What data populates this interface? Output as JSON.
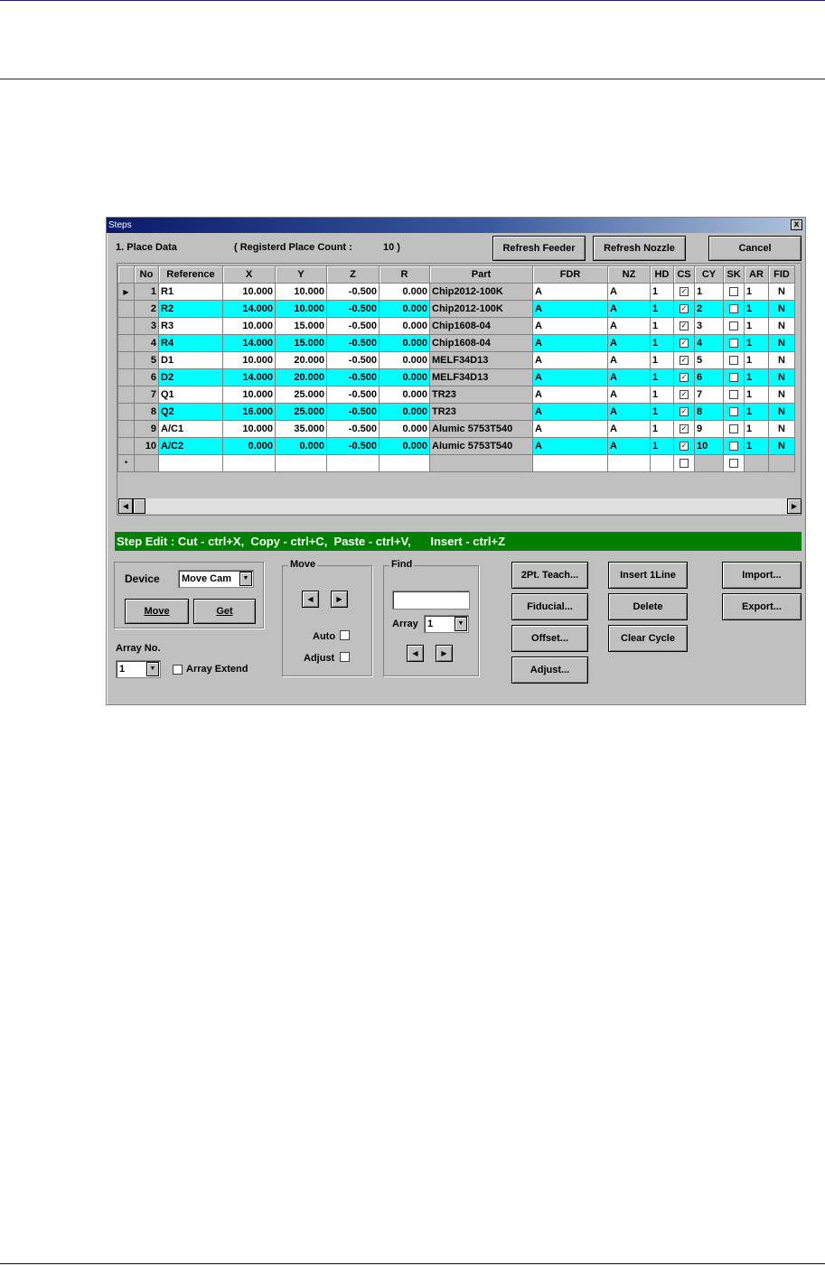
{
  "window": {
    "title": "Steps",
    "close_glyph": "x"
  },
  "header": {
    "section_label": "1. Place Data",
    "count_label": "( Registerd Place Count :",
    "count_value": "10 )",
    "refresh_feeder": "Refresh Feeder",
    "refresh_nozzle": "Refresh Nozzle",
    "cancel": "Cancel"
  },
  "table": {
    "columns": [
      "No",
      "Reference",
      "X",
      "Y",
      "Z",
      "R",
      "Part",
      "FDR",
      "NZ",
      "HD",
      "CS",
      "CY",
      "SK",
      "AR",
      "FID"
    ],
    "rows": [
      {
        "no": "1",
        "ref": "R1",
        "x": "10.000",
        "y": "10.000",
        "z": "-0.500",
        "r": "0.000",
        "part": "Chip2012-100K",
        "fdr": "A",
        "nz": "A",
        "hd": "1",
        "cs": true,
        "cy": "1",
        "sk": false,
        "ar": "1",
        "fid": "N",
        "highlight": false,
        "current": true
      },
      {
        "no": "2",
        "ref": "R2",
        "x": "14.000",
        "y": "10.000",
        "z": "-0.500",
        "r": "0.000",
        "part": "Chip2012-100K",
        "fdr": "A",
        "nz": "A",
        "hd": "1",
        "cs": true,
        "cy": "2",
        "sk": false,
        "ar": "1",
        "fid": "N",
        "highlight": true,
        "current": false
      },
      {
        "no": "3",
        "ref": "R3",
        "x": "10.000",
        "y": "15.000",
        "z": "-0.500",
        "r": "0.000",
        "part": "Chip1608-04",
        "fdr": "A",
        "nz": "A",
        "hd": "1",
        "cs": true,
        "cy": "3",
        "sk": false,
        "ar": "1",
        "fid": "N",
        "highlight": false,
        "current": false
      },
      {
        "no": "4",
        "ref": "R4",
        "x": "14.000",
        "y": "15.000",
        "z": "-0.500",
        "r": "0.000",
        "part": "Chip1608-04",
        "fdr": "A",
        "nz": "A",
        "hd": "1",
        "cs": true,
        "cy": "4",
        "sk": false,
        "ar": "1",
        "fid": "N",
        "highlight": true,
        "current": false
      },
      {
        "no": "5",
        "ref": "D1",
        "x": "10.000",
        "y": "20.000",
        "z": "-0.500",
        "r": "0.000",
        "part": "MELF34D13",
        "fdr": "A",
        "nz": "A",
        "hd": "1",
        "cs": true,
        "cy": "5",
        "sk": false,
        "ar": "1",
        "fid": "N",
        "highlight": false,
        "current": false
      },
      {
        "no": "6",
        "ref": "D2",
        "x": "14.000",
        "y": "20.000",
        "z": "-0.500",
        "r": "0.000",
        "part": "MELF34D13",
        "fdr": "A",
        "nz": "A",
        "hd": "1",
        "cs": true,
        "cy": "6",
        "sk": false,
        "ar": "1",
        "fid": "N",
        "highlight": true,
        "current": false
      },
      {
        "no": "7",
        "ref": "Q1",
        "x": "10.000",
        "y": "25.000",
        "z": "-0.500",
        "r": "0.000",
        "part": "TR23",
        "fdr": "A",
        "nz": "A",
        "hd": "1",
        "cs": true,
        "cy": "7",
        "sk": false,
        "ar": "1",
        "fid": "N",
        "highlight": false,
        "current": false
      },
      {
        "no": "8",
        "ref": "Q2",
        "x": "16.000",
        "y": "25.000",
        "z": "-0.500",
        "r": "0.000",
        "part": "TR23",
        "fdr": "A",
        "nz": "A",
        "hd": "1",
        "cs": true,
        "cy": "8",
        "sk": false,
        "ar": "1",
        "fid": "N",
        "highlight": true,
        "current": false
      },
      {
        "no": "9",
        "ref": "A/C1",
        "x": "10.000",
        "y": "35.000",
        "z": "-0.500",
        "r": "0.000",
        "part": "Alumic 5753T540",
        "fdr": "A",
        "nz": "A",
        "hd": "1",
        "cs": true,
        "cy": "9",
        "sk": false,
        "ar": "1",
        "fid": "N",
        "highlight": false,
        "current": false
      },
      {
        "no": "10",
        "ref": "A/C2",
        "x": "0.000",
        "y": "0.000",
        "z": "-0.500",
        "r": "0.000",
        "part": "Alumic 5753T540",
        "fdr": "A",
        "nz": "A",
        "hd": "1",
        "cs": true,
        "cy": "10",
        "sk": false,
        "ar": "1",
        "fid": "N",
        "highlight": true,
        "current": false
      }
    ],
    "new_row_marker": "*",
    "current_row_marker": "▶"
  },
  "status_text": "Step Edit : Cut - ctrl+X,  Copy - ctrl+C,  Paste - ctrl+V,      Insert - ctrl+Z",
  "device": {
    "label": "Device",
    "value": "Move Cam",
    "move": "Move",
    "get": "Get"
  },
  "array": {
    "label": "Array No.",
    "value": "1",
    "extend": "Array Extend"
  },
  "move_group": {
    "title": "Move",
    "auto": "Auto",
    "adjust": "Adjust"
  },
  "find_group": {
    "title": "Find",
    "array_label": "Array",
    "array_value": "1"
  },
  "buttons": {
    "teach": "2Pt. Teach...",
    "fiducial": "Fiducial...",
    "offset": "Offset...",
    "adjust": "Adjust...",
    "insert": "Insert 1Line",
    "delete": "Delete",
    "clear_cycle": "Clear Cycle",
    "import": "Import...",
    "export": "Export..."
  },
  "colors": {
    "highlight": "#00ffff",
    "status_bar": "#008000",
    "window_face": "#c0c0c0"
  }
}
